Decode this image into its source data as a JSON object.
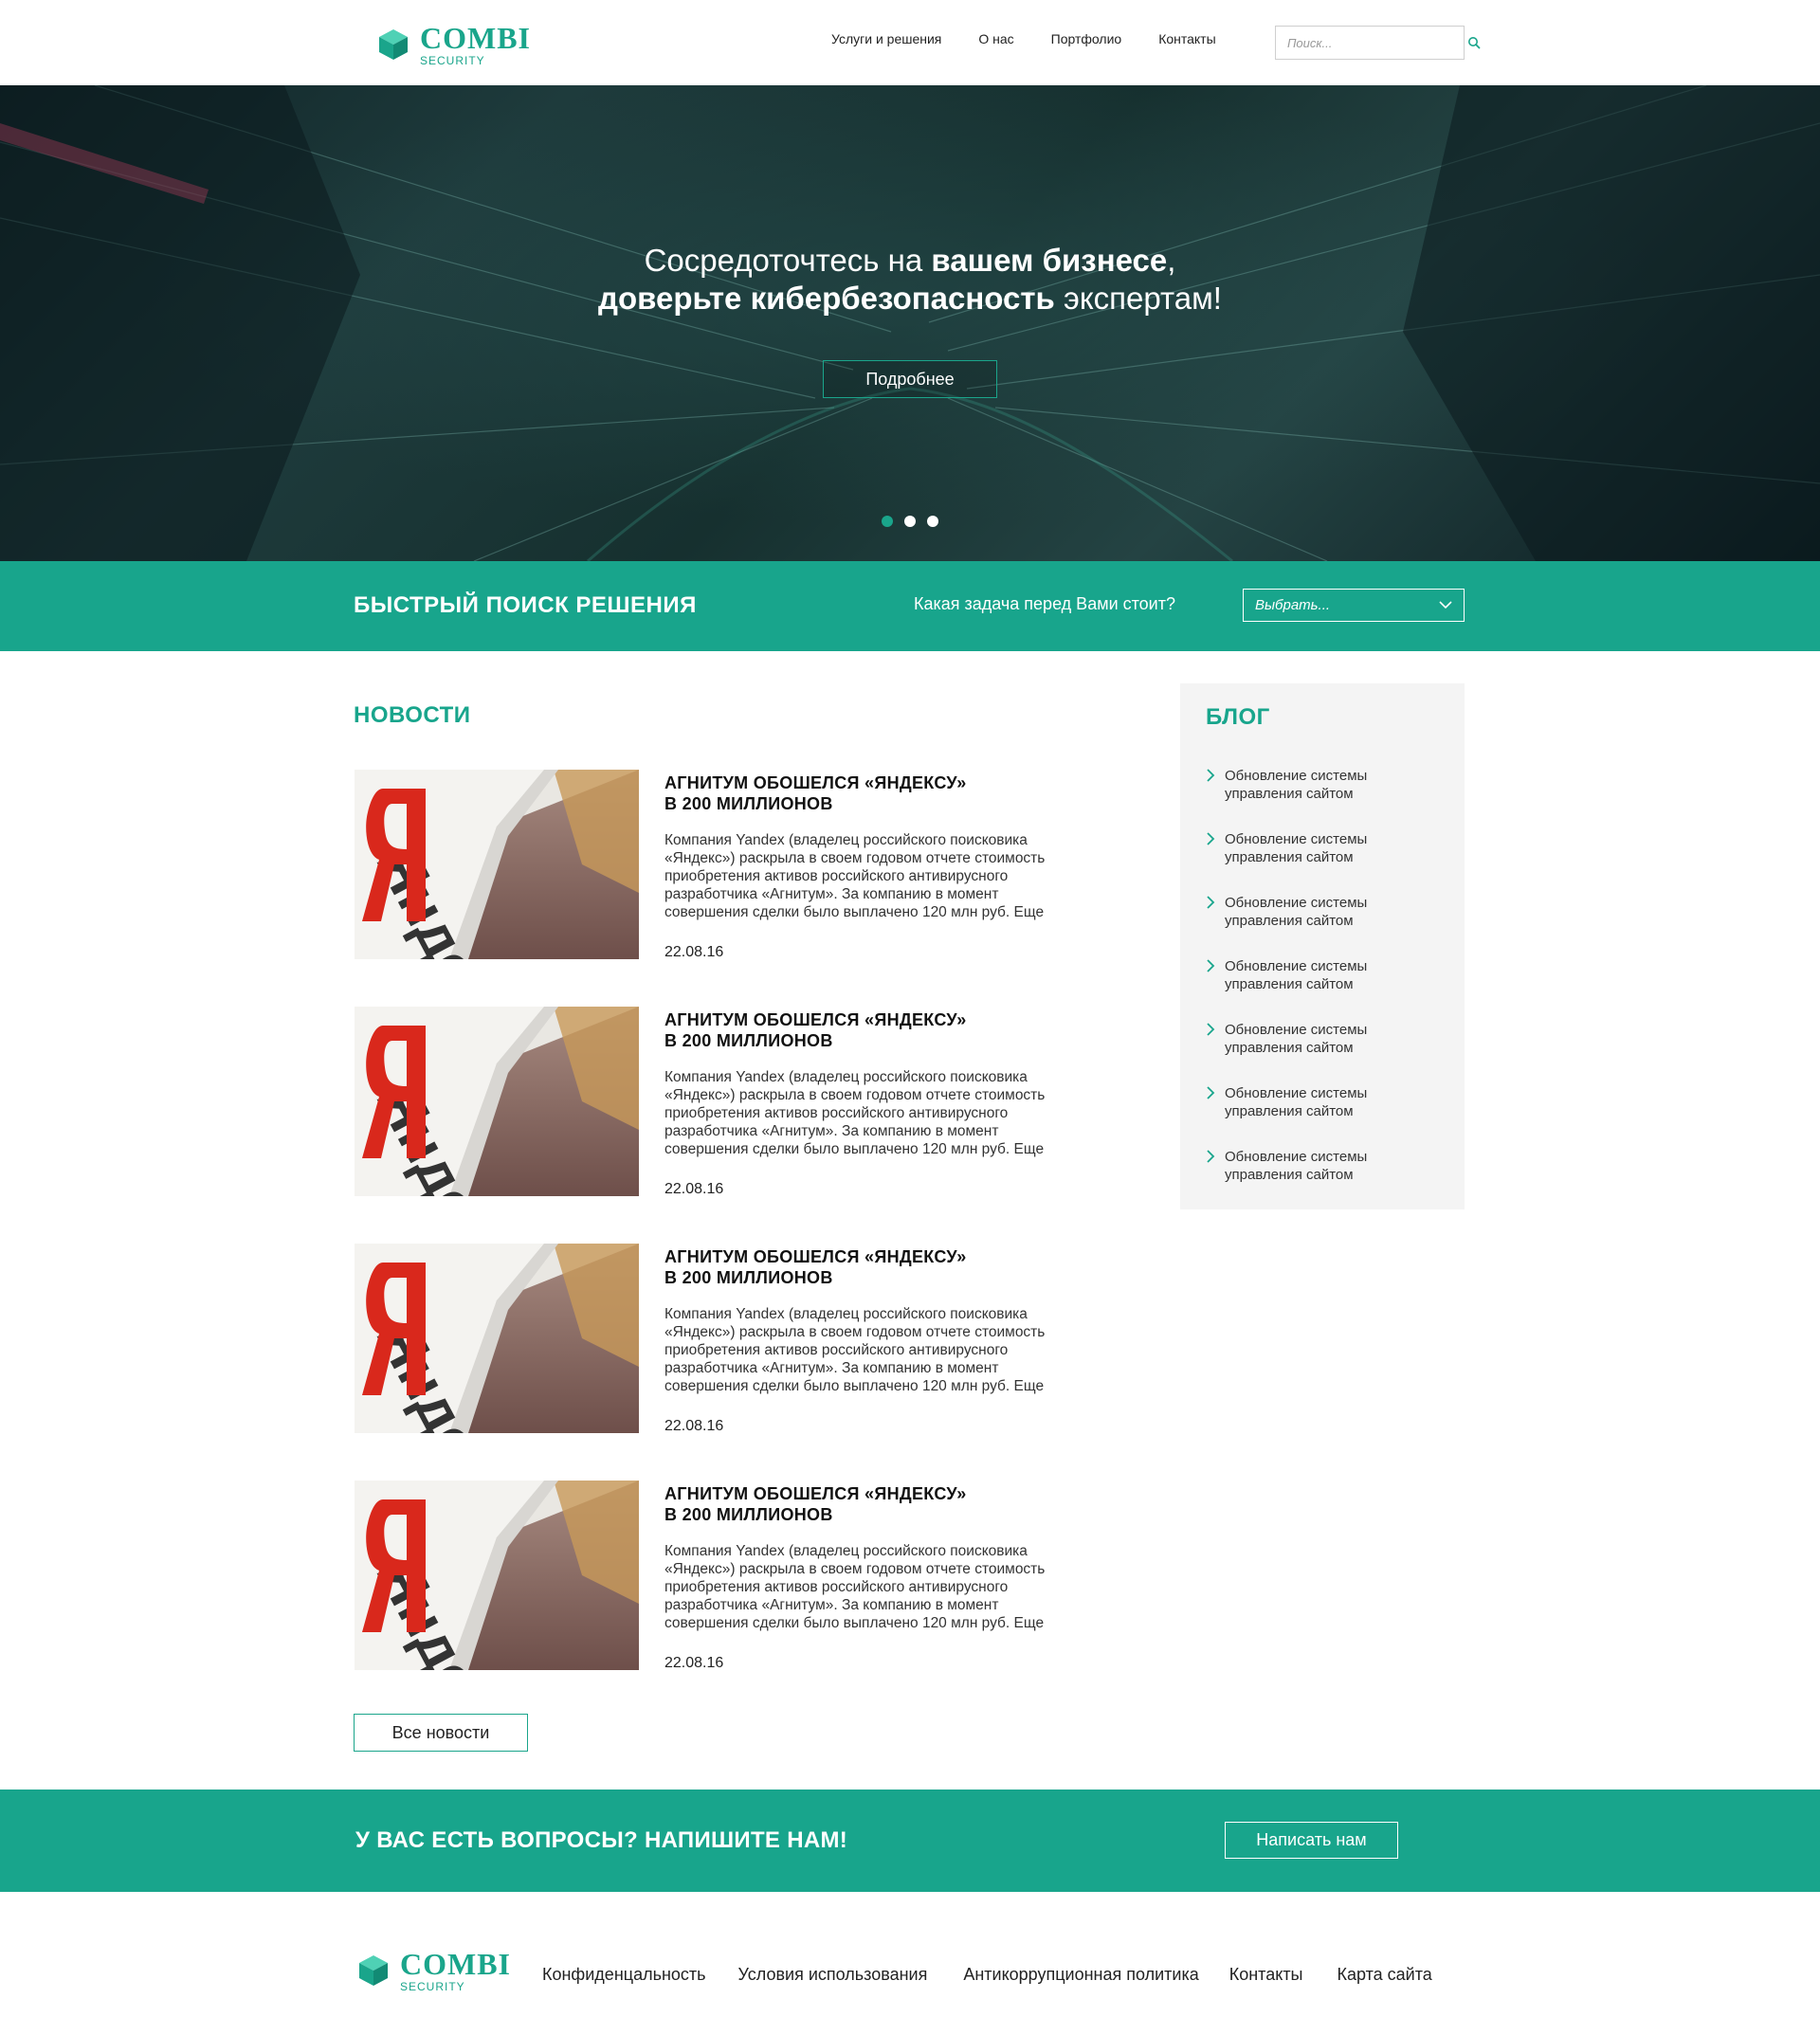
{
  "header": {
    "logo": {
      "brand": "COMBI",
      "sub": "SECURITY"
    },
    "nav": [
      {
        "label": "Услуги и решения"
      },
      {
        "label": "О нас"
      },
      {
        "label": "Портфолио"
      },
      {
        "label": "Контакты"
      }
    ],
    "search": {
      "placeholder": "Поиск...",
      "icon": "search-icon"
    }
  },
  "hero": {
    "line1_normal": "Сосредоточтесь на ",
    "line1_bold": "вашем бизнесе",
    "line1_end": ",",
    "line2_bold": "доверьте кибербезопасность",
    "line2_normal": " экспертам!",
    "button": "Подробнее",
    "slides": 3,
    "active_slide": 1
  },
  "quick_search": {
    "title": "БЫСТРЫЙ ПОИСК РЕШЕНИЯ",
    "question": "Какая задача перед Вами стоит?",
    "select_value": "Выбрать..."
  },
  "news": {
    "title": "НОВОСТИ",
    "items": [
      {
        "title_line1": "АГНИТУМ ОБОШЕЛСЯ «ЯНДЕКСУ»",
        "title_line2": "В 200 МИЛЛИОНОВ",
        "text_lines": [
          "Компания Yandex (владелец российского поисковика",
          "«Яндекс») раскрыла в своем годовом отчете стоимость",
          "приобретения активов российского антивирусного",
          "разработчика «Агнитум». За компанию в момент",
          "совершения сделки было выплачено 120 млн руб. Еще"
        ],
        "date": "22.08.16",
        "image_text": "Яндекс"
      },
      {
        "title_line1": "АГНИТУМ ОБОШЕЛСЯ «ЯНДЕКСУ»",
        "title_line2": "В 200 МИЛЛИОНОВ",
        "text_lines": [
          "Компания Yandex (владелец российского поисковика",
          "«Яндекс») раскрыла в своем годовом отчете стоимость",
          "приобретения активов российского антивирусного",
          "разработчика «Агнитум». За компанию в момент",
          "совершения сделки было выплачено 120 млн руб. Еще"
        ],
        "date": "22.08.16",
        "image_text": "Яндекс"
      },
      {
        "title_line1": "АГНИТУМ ОБОШЕЛСЯ «ЯНДЕКСУ»",
        "title_line2": "В 200 МИЛЛИОНОВ",
        "text_lines": [
          "Компания Yandex (владелец российского поисковика",
          "«Яндекс») раскрыла в своем годовом отчете стоимость",
          "приобретения активов российского антивирусного",
          "разработчика «Агнитум». За компанию в момент",
          "совершения сделки было выплачено 120 млн руб. Еще"
        ],
        "date": "22.08.16",
        "image_text": "Яндекс"
      },
      {
        "title_line1": "АГНИТУМ ОБОШЕЛСЯ «ЯНДЕКСУ»",
        "title_line2": "В 200 МИЛЛИОНОВ",
        "text_lines": [
          "Компания Yandex (владелец российского поисковика",
          "«Яндекс») раскрыла в своем годовом отчете стоимость",
          "приобретения активов российского антивирусного",
          "разработчика «Агнитум». За компанию в момент",
          "совершения сделки было выплачено 120 млн руб. Еще"
        ],
        "date": "22.08.16",
        "image_text": "Яндекс"
      }
    ],
    "all_button": "Все новости"
  },
  "blog": {
    "title": "БЛОГ",
    "items": [
      {
        "line1": "Обновление системы",
        "line2": "управления сайтом"
      },
      {
        "line1": "Обновление системы",
        "line2": "управления сайтом"
      },
      {
        "line1": "Обновление системы",
        "line2": "управления сайтом"
      },
      {
        "line1": "Обновление системы",
        "line2": "управления сайтом"
      },
      {
        "line1": "Обновление системы",
        "line2": "управления сайтом"
      },
      {
        "line1": "Обновление системы",
        "line2": "управления сайтом"
      },
      {
        "line1": "Обновление системы",
        "line2": "управления сайтом"
      }
    ]
  },
  "cta": {
    "title": "У ВАС ЕСТЬ ВОПРОСЫ? НАПИШИТЕ НАМ!",
    "button": "Написать нам"
  },
  "footer": {
    "logo": {
      "brand": "COMBI",
      "sub": "SECURITY"
    },
    "links": [
      {
        "label": "Конфиденцальность"
      },
      {
        "label": "Условия использования"
      },
      {
        "label": "Антикоррупционная политика"
      },
      {
        "label": "Контакты"
      },
      {
        "label": "Карта сайта"
      }
    ]
  },
  "colors": {
    "accent": "#18a58c",
    "blog_bg": "#f4f4f4",
    "text": "#222222"
  }
}
